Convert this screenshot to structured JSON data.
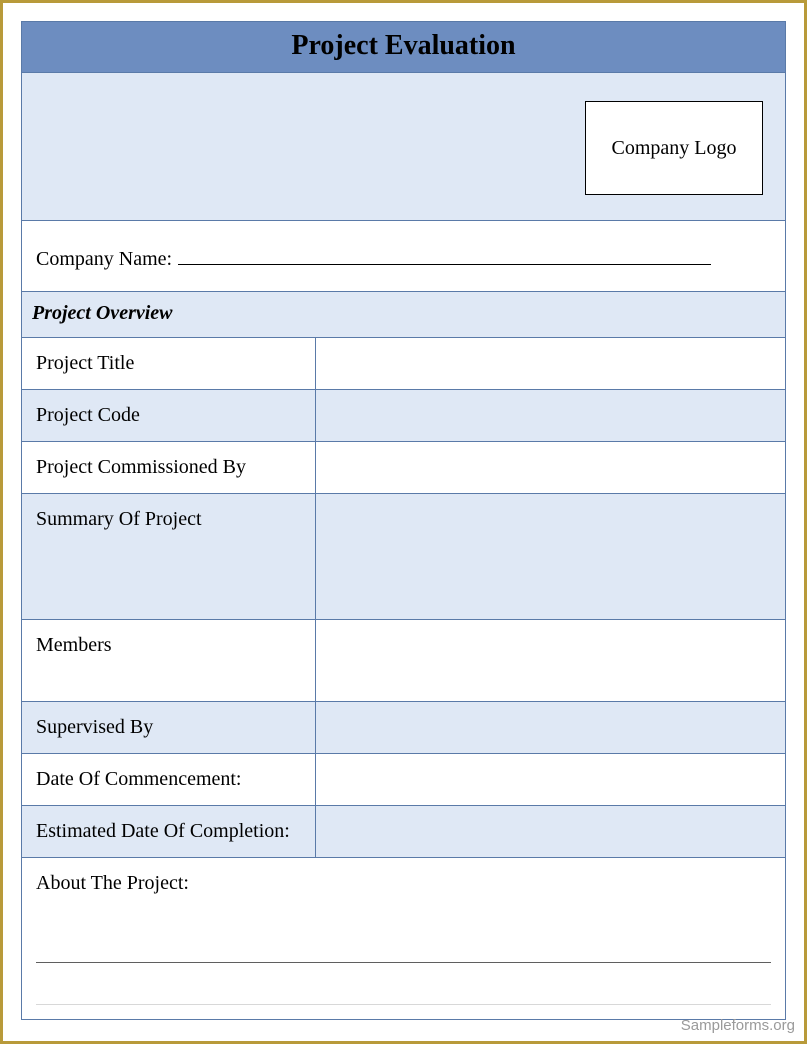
{
  "title": "Project Evaluation",
  "logo_label": "Company Logo",
  "company_name_label": "Company Name:",
  "section_overview": "Project Overview",
  "rows": {
    "project_title": "Project Title",
    "project_code": "Project Code",
    "commissioned_by": "Project Commissioned By",
    "summary": "Summary Of Project",
    "members": "Members",
    "supervised_by": "Supervised By",
    "date_commencement": "Date Of Commencement:",
    "date_completion": "Estimated Date Of Completion:"
  },
  "about_label": "About The Project:",
  "watermark": "Sampleforms.org"
}
